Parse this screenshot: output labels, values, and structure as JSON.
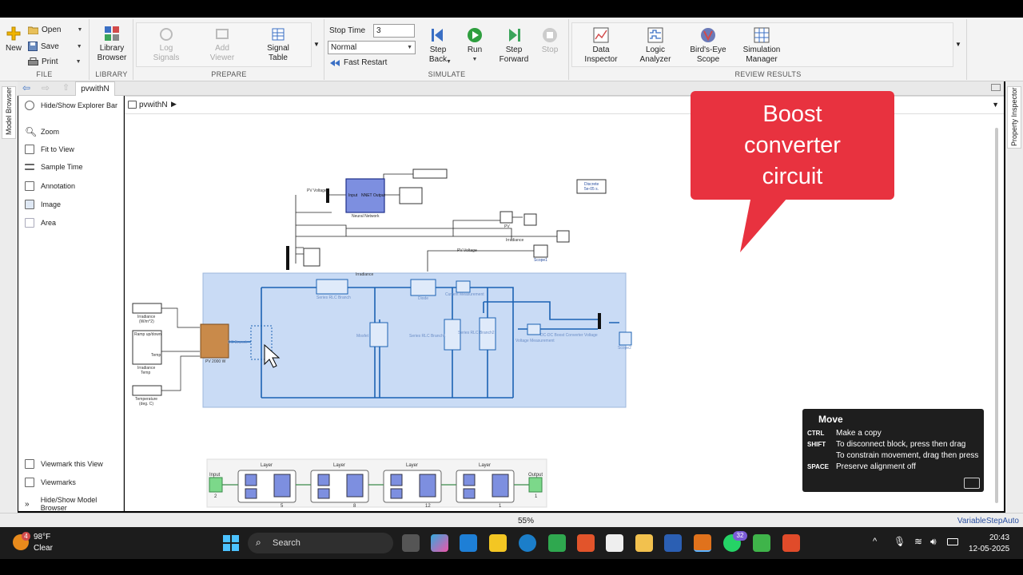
{
  "ribbon": {
    "file": {
      "title": "FILE",
      "new": "New",
      "open": "Open",
      "save": "Save",
      "print": "Print"
    },
    "library": {
      "title": "LIBRARY",
      "browser_line1": "Library",
      "browser_line2": "Browser"
    },
    "prepare": {
      "title": "PREPARE",
      "log_line1": "Log",
      "log_line2": "Signals",
      "add_line1": "Add",
      "add_line2": "Viewer",
      "signal_line1": "Signal",
      "signal_line2": "Table"
    },
    "simulate": {
      "title": "SIMULATE",
      "stop_time_label": "Stop Time",
      "stop_time_value": "3",
      "mode": "Normal",
      "fast_restart": "Fast Restart",
      "step_back_line1": "Step",
      "step_back_line2": "Back",
      "run": "Run",
      "step_fwd_line1": "Step",
      "step_fwd_line2": "Forward",
      "stop": "Stop"
    },
    "review": {
      "title": "REVIEW RESULTS",
      "data_line1": "Data",
      "data_line2": "Inspector",
      "logic_line1": "Logic",
      "logic_line2": "Analyzer",
      "birds_line1": "Bird's-Eye",
      "birds_line2": "Scope",
      "simmgr_line1": "Simulation",
      "simmgr_line2": "Manager"
    }
  },
  "side": {
    "model_browser": "Model Browser",
    "property_inspector": "Property Inspector"
  },
  "tab": {
    "model_name": "pvwithN"
  },
  "breadcrumb": {
    "model": "pvwithN"
  },
  "palette": {
    "hide_explorer": "Hide/Show Explorer Bar",
    "zoom": "Zoom",
    "fit": "Fit to View",
    "sample_time": "Sample Time",
    "annotation": "Annotation",
    "image": "Image",
    "area": "Area",
    "viewmark_this": "Viewmark this View",
    "viewmarks": "Viewmarks",
    "hide_model_browser": "Hide/Show Model Browser"
  },
  "diagram": {
    "pv_voltage": "PV Voltage",
    "input": "Input",
    "nnet_output": "NNET Output",
    "neural_network": "Neural Network",
    "discrete_line1": "Discrete",
    "discrete_line2": "5e-05 s.",
    "pv": "PV",
    "irradiance_sig": "Irradiance",
    "scope": "Scope1",
    "pv_voltage2": "PV Voltage",
    "irradiance_top": "Irradiance",
    "irr_line1": "Irradiance",
    "irr_line2": "(W/m^2)",
    "ramp": "Ramp up/down",
    "irr_temp_line1": "Irradiance",
    "irr_temp_line2": "Temp",
    "temp_line1": "Temperature",
    "temp_line2": "(deg. C)",
    "pv_array": "PV 2000 W",
    "temp_port": "Temp",
    "series_rlc": "Series RLC Branch",
    "diode": "Diode",
    "current_meas": "Current Measurement",
    "mosfet": "Mosfet",
    "series_rlc2": "Series RLC Branch1",
    "series_rlc3": "Series RLC Branch2",
    "voltage_meas": "Voltage Measurement",
    "dc_boost": "DC-DC Boost Converter Voltage",
    "scope2": "Scope2",
    "dc_src": "DC Branch",
    "layer": "Layer",
    "input_lbl": "Input",
    "output_lbl": "Output",
    "in_count": "2",
    "out_count": "1",
    "layer_counts": [
      "5",
      "8",
      "12",
      "1"
    ]
  },
  "callout": {
    "line1": "Boost",
    "line2": "converter",
    "line3": "circuit"
  },
  "tooltip": {
    "title": "Move",
    "rows": [
      {
        "key": "CTRL",
        "text": "Make a copy"
      },
      {
        "key": "SHIFT",
        "text": "To disconnect block, press then drag"
      },
      {
        "key": "",
        "text": "To constrain movement, drag then press"
      },
      {
        "key": "SPACE",
        "text": "Preserve alignment off"
      }
    ]
  },
  "status": {
    "zoom": "55%",
    "solver": "VariableStepAuto"
  },
  "taskbar": {
    "temp": "98°F",
    "weather": "Clear",
    "weather_badge": "4",
    "search": "Search",
    "whatsapp_badge": "32",
    "time": "20:43",
    "date": "12-05-2025"
  }
}
